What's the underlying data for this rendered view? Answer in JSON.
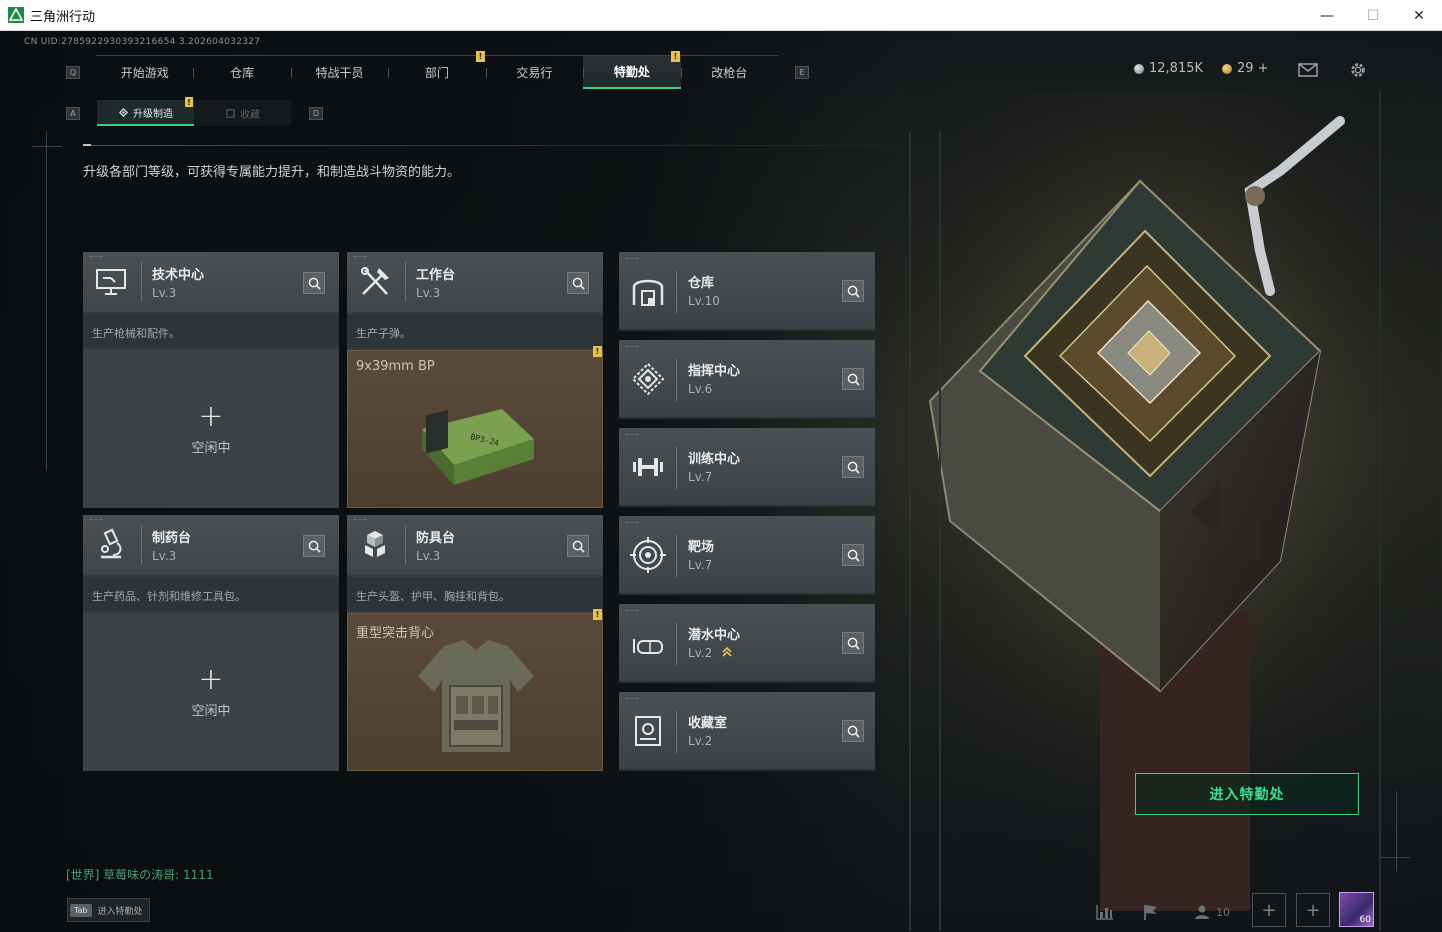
{
  "window": {
    "title": "三角洲行动",
    "minimize": "—",
    "maximize": "☐",
    "close": "✕"
  },
  "uid": "CN UID:2785922930393216654 3.202604032327",
  "nav": {
    "key_left": "Q",
    "key_right": "E",
    "tabs": [
      {
        "label": "开始游戏"
      },
      {
        "label": "仓库"
      },
      {
        "label": "特战干员"
      },
      {
        "label": "部门"
      },
      {
        "label": "交易行"
      },
      {
        "label": "特勤处",
        "active": true
      },
      {
        "label": "改枪台"
      }
    ]
  },
  "sub_nav": {
    "key_left": "A",
    "key_right": "D",
    "tabs": [
      {
        "label": "升级制造",
        "active": true
      },
      {
        "label": "收藏"
      }
    ]
  },
  "currency": {
    "silver": "12,815K",
    "gold": "29 +"
  },
  "description": "升级各部门等级，可获得专属能力提升，和制造战斗物资的能力。",
  "facilities": [
    {
      "name": "技术中心",
      "level": "Lv.3",
      "desc": "生产枪械和配件。",
      "status": "空闲中",
      "icon": "monitor-icon"
    },
    {
      "name": "工作台",
      "level": "Lv.3",
      "desc": "生产子弹。",
      "product": "9x39mm BP",
      "icon": "hammer-wrench-icon"
    },
    {
      "name": "制药台",
      "level": "Lv.3",
      "desc": "生产药品、针剂和维修工具包。",
      "status": "空闲中",
      "icon": "microscope-icon"
    },
    {
      "name": "防具台",
      "level": "Lv.3",
      "desc": "生产头盔、护甲、胸挂和背包。",
      "product": "重型突击背心",
      "icon": "blocks-icon"
    }
  ],
  "side_facilities": [
    {
      "name": "仓库",
      "level": "Lv.10",
      "icon": "warehouse-icon"
    },
    {
      "name": "指挥中心",
      "level": "Lv.6",
      "icon": "command-icon"
    },
    {
      "name": "训练中心",
      "level": "Lv.7",
      "icon": "dumbbell-icon"
    },
    {
      "name": "靶场",
      "level": "Lv.7",
      "icon": "target-icon"
    },
    {
      "name": "潜水中心",
      "level": "Lv.2",
      "icon": "diving-mask-icon",
      "upgradable": true
    },
    {
      "name": "收藏室",
      "level": "Lv.2",
      "icon": "collection-icon"
    }
  ],
  "enter_button": "进入特勤处",
  "chat": "[世界] 草莓味の涛哥: 1111",
  "tab_hint": {
    "key": "Tab",
    "label": "进入特勤处"
  },
  "friends_count": "10",
  "avatar_level": "60",
  "colors": {
    "accent": "#3ad08a",
    "alert": "#e6c24a",
    "card": "#474d51"
  }
}
